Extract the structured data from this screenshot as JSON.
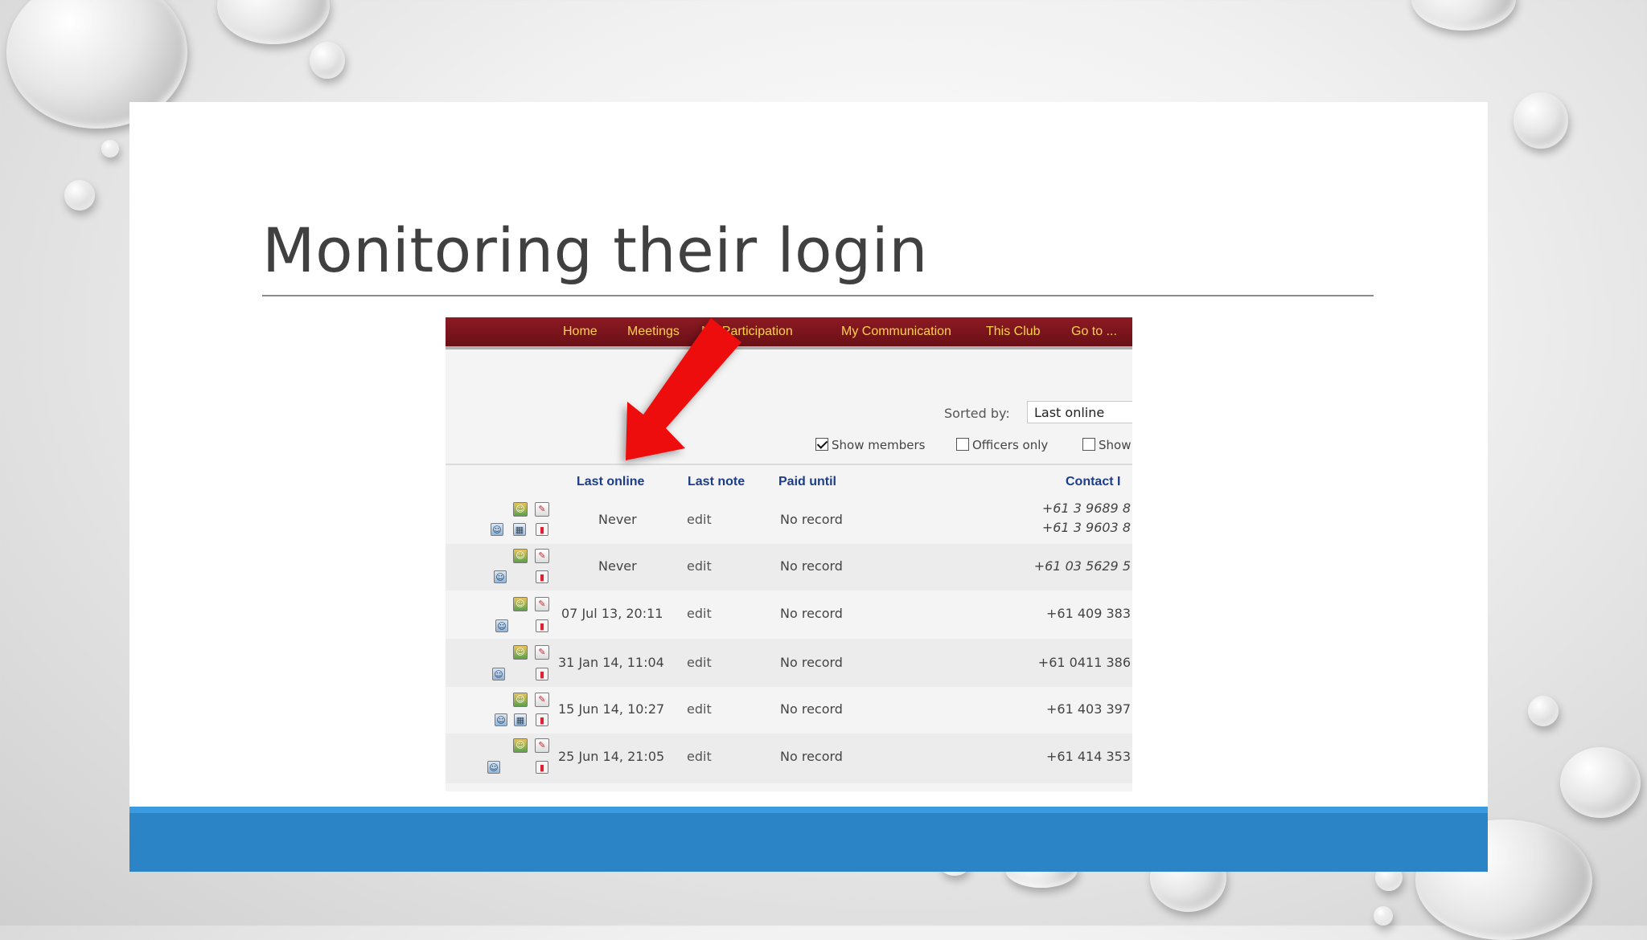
{
  "slide": {
    "title": "Monitoring their login"
  },
  "nav": {
    "items": [
      "Home",
      "Meetings",
      "My Participation",
      "My Communication",
      "This Club",
      "Go to ..."
    ]
  },
  "controls": {
    "sorted_label": "Sorted by:",
    "sorted_value": "Last online",
    "show_members": {
      "label": "Show members",
      "checked": true
    },
    "officers_only": {
      "label": "Officers only",
      "checked": false
    },
    "show_other": {
      "label": "Show",
      "checked": false
    }
  },
  "table": {
    "columns": [
      "Last online",
      "Last note",
      "Paid until",
      "Contact I"
    ],
    "rows": [
      {
        "last_online": "Never",
        "last_note": "edit",
        "paid_until": "No record",
        "contact": [
          "+61 3 9689 8",
          "+61 3 9603 8"
        ],
        "italic": true,
        "icons": [
          "person",
          "pencil",
          "small-person",
          "cal",
          "chart"
        ]
      },
      {
        "last_online": "Never",
        "last_note": "edit",
        "paid_until": "No record",
        "contact": [
          "+61 03 5629 5"
        ],
        "italic": true,
        "icons": [
          "person",
          "pencil",
          "small-person",
          "chart"
        ]
      },
      {
        "last_online": "07 Jul 13, 20:11",
        "last_note": "edit",
        "paid_until": "No record",
        "contact": [
          "+61 409 383"
        ],
        "italic": false,
        "icons": [
          "person",
          "pencil",
          "small-person",
          "chart"
        ]
      },
      {
        "last_online": "31 Jan 14, 11:04",
        "last_note": "edit",
        "paid_until": "No record",
        "contact": [
          "+61 0411 386"
        ],
        "italic": false,
        "icons": [
          "person",
          "pencil",
          "small-person",
          "chart"
        ]
      },
      {
        "last_online": "15 Jun 14, 10:27",
        "last_note": "edit",
        "paid_until": "No record",
        "contact": [
          "+61 403 397"
        ],
        "italic": false,
        "icons": [
          "person",
          "pencil",
          "small-person",
          "cal",
          "chart"
        ]
      },
      {
        "last_online": "25 Jun 14, 21:05",
        "last_note": "edit",
        "paid_until": "No record",
        "contact": [
          "+61 414 353"
        ],
        "italic": false,
        "icons": [
          "person",
          "pencil",
          "small-person",
          "chart"
        ]
      }
    ]
  },
  "colors": {
    "nav_bg": "#7a121a",
    "nav_text": "#ffd24a",
    "header_text": "#1c3d8a",
    "footer_bar": "#2a84c6",
    "arrow": "#ee1111"
  },
  "icons": [
    "person-icon",
    "pencil-icon",
    "member-icon",
    "calendar-icon",
    "chart-icon",
    "red-arrow-icon"
  ]
}
